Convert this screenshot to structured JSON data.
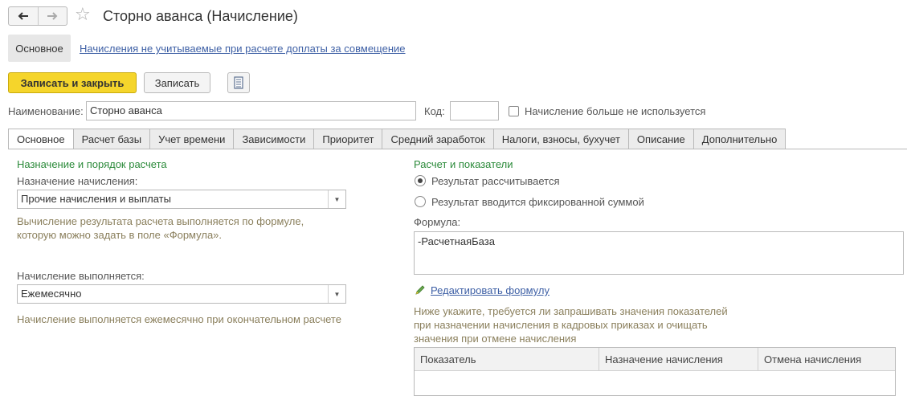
{
  "header": {
    "back_icon": "arrow-left-icon",
    "forward_icon": "arrow-right-icon",
    "favorite_icon": "star-icon",
    "title": "Сторно аванса (Начисление)"
  },
  "nav_panel": {
    "main_label": "Основное",
    "link_label": "Начисления не учитываемые при расчете доплаты за совмещение"
  },
  "command_bar": {
    "save_close_label": "Записать и закрыть",
    "save_label": "Записать",
    "report_icon": "document-list-icon"
  },
  "name_row": {
    "name_label": "Наименование:",
    "name_value": "Сторно аванса",
    "code_label": "Код:",
    "code_value": "",
    "not_used_label": "Начисление больше не используется"
  },
  "tabs": [
    {
      "label": "Основное"
    },
    {
      "label": "Расчет базы"
    },
    {
      "label": "Учет времени"
    },
    {
      "label": "Зависимости"
    },
    {
      "label": "Приоритет"
    },
    {
      "label": "Средний заработок"
    },
    {
      "label": "Налоги, взносы, бухучет"
    },
    {
      "label": "Описание"
    },
    {
      "label": "Дополнительно"
    }
  ],
  "left_panel": {
    "section_title": "Назначение и порядок расчета",
    "purpose_label": "Назначение начисления:",
    "purpose_value": "Прочие начисления и выплаты",
    "purpose_hint_line1": "Вычисление результата расчета выполняется по формуле,",
    "purpose_hint_line2": "которую можно задать в поле «Формула».",
    "frequency_label": "Начисление выполняется:",
    "frequency_value": "Ежемесячно",
    "frequency_hint": "Начисление выполняется ежемесячно при окончательном расчете"
  },
  "right_panel": {
    "section_title": "Расчет и показатели",
    "radio_calculated": "Результат рассчитывается",
    "radio_fixed": "Результат вводится фиксированной суммой",
    "formula_label": "Формула:",
    "formula_value": "-РасчетнаяБаза",
    "edit_formula_icon": "pencil-icon",
    "edit_formula_label": "Редактировать формулу",
    "indicators_hint_line1": "Ниже укажите, требуется ли запрашивать значения показателей",
    "indicators_hint_line2": "при назначении начисления в кадровых приказах и очищать",
    "indicators_hint_line3": "значения при отмене начисления",
    "table_columns": [
      "Показатель",
      "Назначение начисления",
      "Отмена начисления"
    ]
  },
  "colors": {
    "accent_yellow": "#f5d52b",
    "section_green": "#2b8a3a",
    "link_blue": "#3d5fa5",
    "hint_brown": "#8a7f5c"
  }
}
